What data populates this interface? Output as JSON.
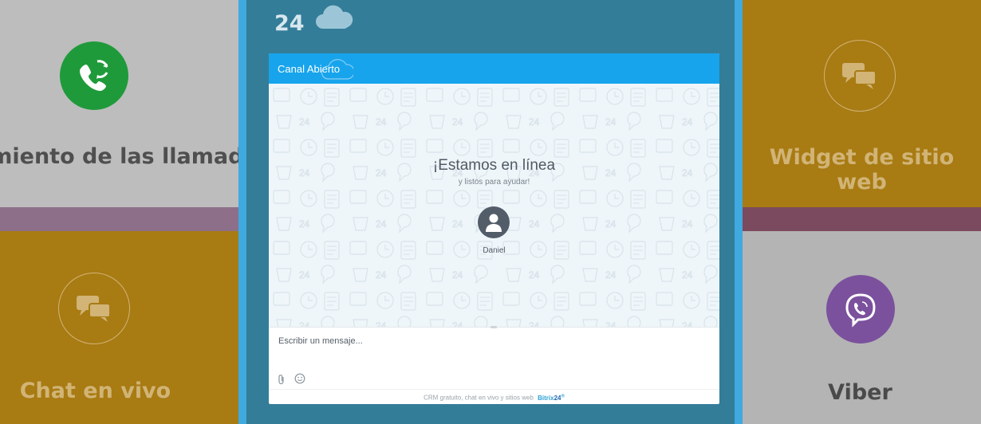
{
  "tiles": {
    "call_tracking": {
      "title": "imiento de las llamadas",
      "icon": "phone-refresh-icon",
      "color": "#1f9a3a"
    },
    "live_chat": {
      "title": "Chat en vivo",
      "icon": "chat-bubbles-icon"
    },
    "website_widget": {
      "title": "Widget de sitio web",
      "icon": "chat-bubbles-icon"
    },
    "viber": {
      "title": "Viber",
      "icon": "viber-icon",
      "color": "#7b519d"
    }
  },
  "brand": {
    "number": "24",
    "icon": "cloud-icon"
  },
  "widget": {
    "header_title": "Canal Abierto",
    "online_title": "¡Estamos en línea",
    "online_subtitle": "y listos para ayudar!",
    "operator_name": "Daniel",
    "input_placeholder": "Escribir un mensaje...",
    "footer_text": "CRM gratuito, chat en vivo y sitios web",
    "footer_brand": "Bitrix",
    "footer_brand_num": "24",
    "accent": "#17a4ec"
  }
}
